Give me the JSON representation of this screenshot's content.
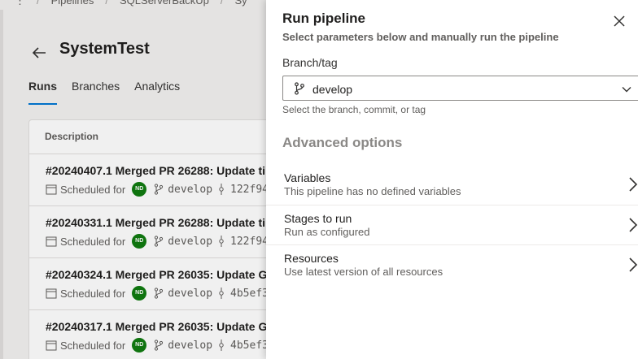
{
  "breadcrumb": {
    "items": [
      "Pipelines",
      "SQLServerBackUp",
      "Sy"
    ],
    "menu": "⋮",
    "separator": "/"
  },
  "page": {
    "title": "SystemTest",
    "tabs": [
      "Runs",
      "Branches",
      "Analytics"
    ],
    "active_tab": "Runs"
  },
  "runs_table": {
    "header": "Description",
    "rows": [
      {
        "title": "#20240407.1 Merged PR 26288: Update ti",
        "trigger": "Scheduled for",
        "avatar": "ND",
        "branch": "develop",
        "commit": "122f94"
      },
      {
        "title": "#20240331.1 Merged PR 26288: Update ti",
        "trigger": "Scheduled for",
        "avatar": "ND",
        "branch": "develop",
        "commit": "122f94"
      },
      {
        "title": "#20240324.1 Merged PR 26035: Update G",
        "trigger": "Scheduled for",
        "avatar": "ND",
        "branch": "develop",
        "commit": "4b5ef3"
      },
      {
        "title": "#20240317.1 Merged PR 26035: Update G",
        "trigger": "Scheduled for",
        "avatar": "ND",
        "branch": "develop",
        "commit": "4b5ef3"
      }
    ]
  },
  "panel": {
    "title": "Run pipeline",
    "subtitle": "Select parameters below and manually run the pipeline",
    "branch_label": "Branch/tag",
    "branch_value": "develop",
    "branch_hint": "Select the branch, commit, or tag",
    "advanced_title": "Advanced options",
    "options": [
      {
        "name": "Variables",
        "desc": "This pipeline has no defined variables"
      },
      {
        "name": "Stages to run",
        "desc": "Run as configured"
      },
      {
        "name": "Resources",
        "desc": "Use latest version of all resources"
      }
    ]
  },
  "colors": {
    "accent": "#0078d4",
    "avatar": "#107c10"
  },
  "icons": [
    "back-arrow-icon",
    "calendar-icon",
    "branch-icon",
    "commit-icon",
    "close-icon",
    "chevron-down-icon",
    "chevron-right-icon"
  ]
}
